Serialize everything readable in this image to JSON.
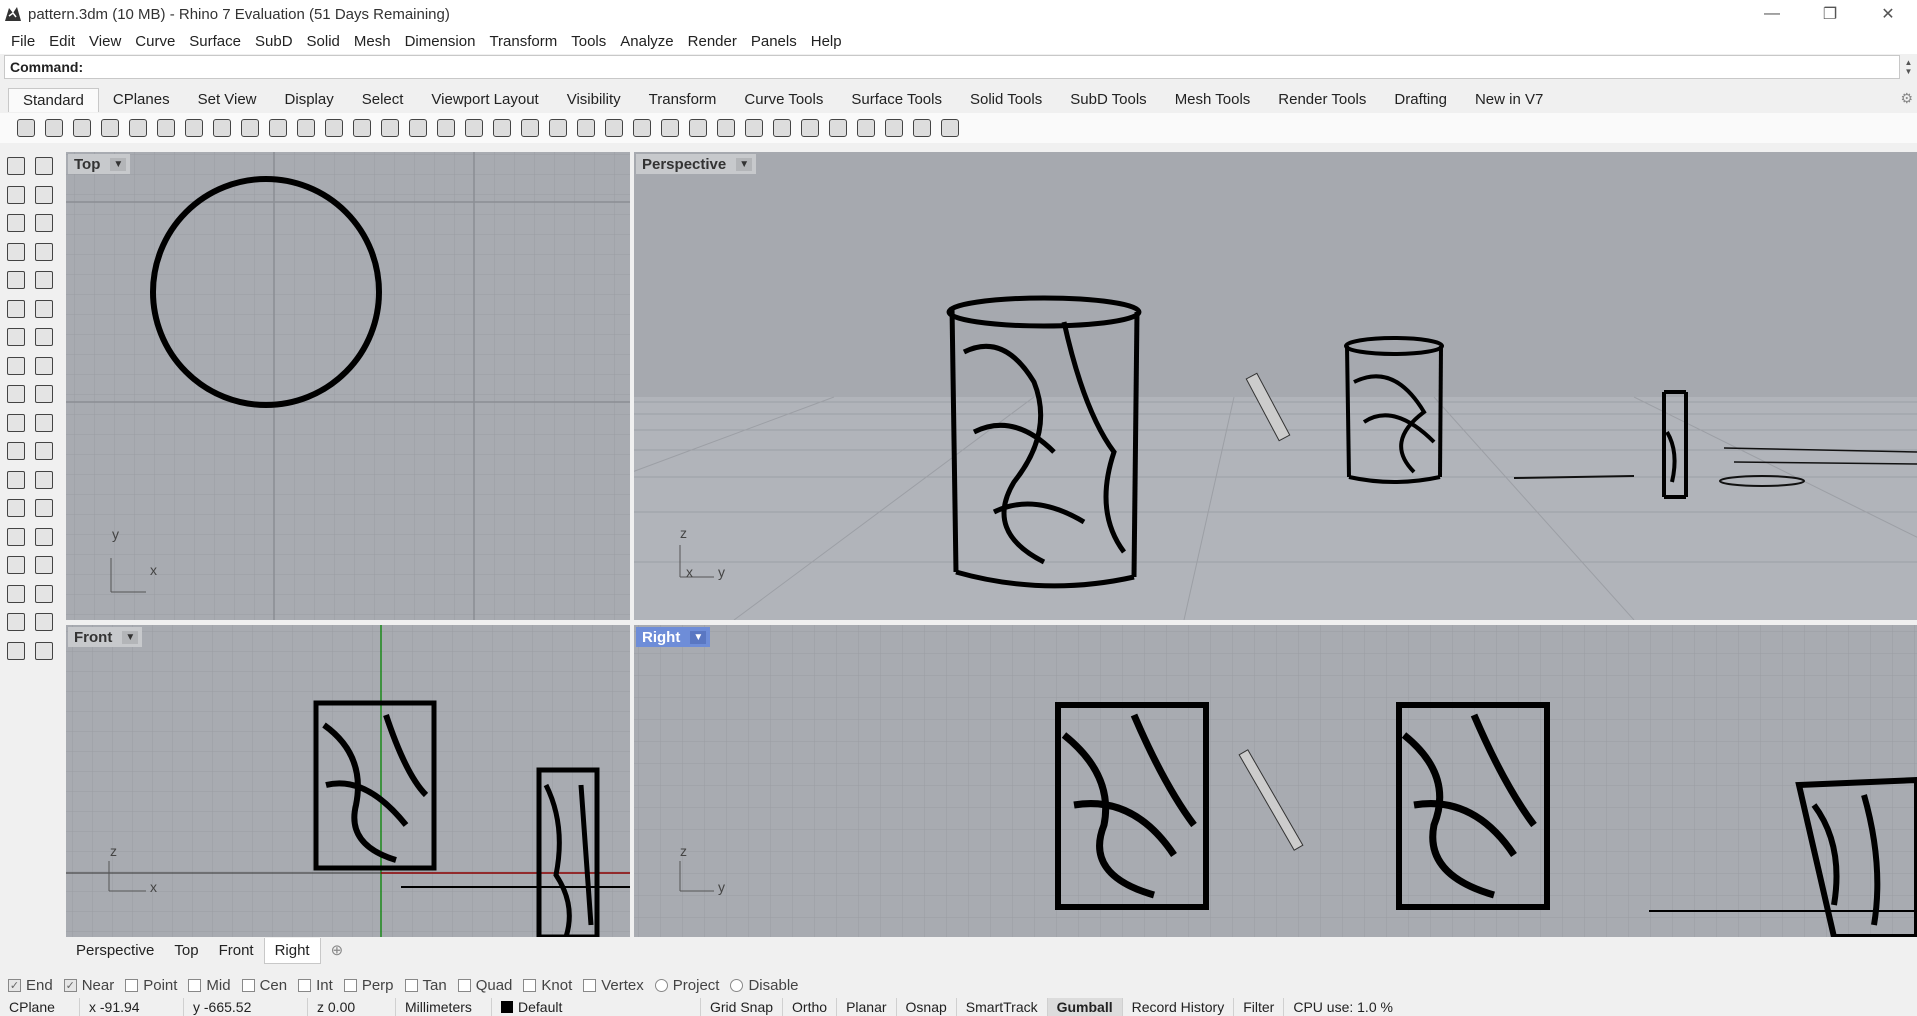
{
  "window": {
    "title": "pattern.3dm (10 MB) - Rhino 7 Evaluation (51 Days Remaining)",
    "controls": {
      "minimize": "—",
      "restore": "❐",
      "close": "✕"
    }
  },
  "menu": [
    "File",
    "Edit",
    "View",
    "Curve",
    "Surface",
    "SubD",
    "Solid",
    "Mesh",
    "Dimension",
    "Transform",
    "Tools",
    "Analyze",
    "Render",
    "Panels",
    "Help"
  ],
  "command": {
    "label": "Command:",
    "value": ""
  },
  "toolbar_tabs": [
    "Standard",
    "CPlanes",
    "Set View",
    "Display",
    "Select",
    "Viewport Layout",
    "Visibility",
    "Transform",
    "Curve Tools",
    "Surface Tools",
    "Solid Tools",
    "SubD Tools",
    "Mesh Tools",
    "Render Tools",
    "Drafting",
    "New in V7"
  ],
  "toolbar_icons": [
    "new-icon",
    "open-icon",
    "save-icon",
    "print-icon",
    "import-icon",
    "cut-icon",
    "copy-icon",
    "paste-icon",
    "undo-icon",
    "pan-icon",
    "rotate-view-icon",
    "zoom-dynamic-icon",
    "zoom-window-icon",
    "zoom-extents-icon",
    "zoom-selected-icon",
    "rotate-icon",
    "four-viewports-icon",
    "car-icon",
    "hide-icon",
    "show-icon",
    "select-icon",
    "light-icon",
    "lock-icon",
    "layer-icon",
    "color-wheel-icon",
    "shaded-icon",
    "rendered-icon",
    "ghosted-icon",
    "render-icon",
    "options-icon",
    "gears-icon",
    "dimension-icon",
    "globe-icon",
    "help-icon"
  ],
  "left_tool_icons": [
    "select-arrow-icon",
    "point-icon",
    "polyline-icon",
    "curve-icon",
    "circle-icon",
    "arc-icon",
    "polygon-icon",
    "rectangle-icon",
    "ellipse-icon",
    "fillet-icon",
    "surface-icon",
    "loft-icon",
    "box-icon",
    "sphere-icon",
    "extrude-icon",
    "patch-icon",
    "explode-icon",
    "trim-icon",
    "split-icon",
    "join-icon",
    "boolean-icon",
    "group-icon",
    "offset-icon",
    "curve-fillet-icon",
    "text-icon",
    "scale-icon",
    "array-icon",
    "move-icon",
    "block-icon",
    "dim-icon",
    "grid-icon",
    "snap-icon",
    "analyze-icon",
    "check-icon",
    "render-icon-small",
    "material-icon"
  ],
  "viewports": {
    "top": {
      "label": "Top",
      "axes": {
        "a": "y",
        "b": "x"
      }
    },
    "perspective": {
      "label": "Perspective",
      "axes": {
        "a": "z",
        "b": "x",
        "c": "y"
      }
    },
    "front": {
      "label": "Front",
      "axes": {
        "a": "z",
        "b": "x"
      }
    },
    "right": {
      "label": "Right",
      "axes": {
        "a": "z",
        "b": "y"
      }
    }
  },
  "viewport_tabs": [
    "Perspective",
    "Top",
    "Front",
    "Right"
  ],
  "viewport_tabs_active": "Right",
  "osnaps": [
    {
      "label": "End",
      "checked": true
    },
    {
      "label": "Near",
      "checked": true
    },
    {
      "label": "Point",
      "checked": false
    },
    {
      "label": "Mid",
      "checked": false
    },
    {
      "label": "Cen",
      "checked": false
    },
    {
      "label": "Int",
      "checked": false
    },
    {
      "label": "Perp",
      "checked": false
    },
    {
      "label": "Tan",
      "checked": false
    },
    {
      "label": "Quad",
      "checked": false
    },
    {
      "label": "Knot",
      "checked": false
    },
    {
      "label": "Vertex",
      "checked": false
    },
    {
      "label": "Project",
      "checked": false
    },
    {
      "label": "Disable",
      "checked": false
    }
  ],
  "status": {
    "cplane": "CPlane",
    "x": "x -91.94",
    "y": "y -665.52",
    "z": "z 0.00",
    "units": "Millimeters",
    "layer": "Default",
    "grid_snap": "Grid Snap",
    "ortho": "Ortho",
    "planar": "Planar",
    "osnap": "Osnap",
    "smarttrack": "SmartTrack",
    "gumball": "Gumball",
    "record_history": "Record History",
    "filter": "Filter",
    "cpu": "CPU use: 1.0 %"
  },
  "colors": {
    "viewport_bg": "#a8abb1",
    "active_viewport_label": "#6e8dd8",
    "grid_axis_x": "#8b0000",
    "grid_axis_y": "#1a8a1a"
  }
}
